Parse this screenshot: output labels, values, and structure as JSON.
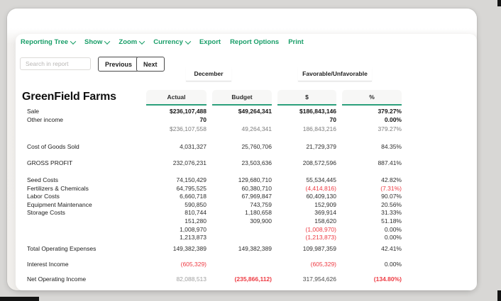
{
  "toolbar": {
    "items": [
      {
        "label": "Reporting Tree",
        "caret": true
      },
      {
        "label": "Show",
        "caret": true
      },
      {
        "label": "Zoom",
        "caret": true
      },
      {
        "label": "Currency",
        "caret": true
      },
      {
        "label": "Export",
        "caret": false
      },
      {
        "label": "Report Options",
        "caret": false
      },
      {
        "label": "Print",
        "caret": false
      }
    ]
  },
  "search": {
    "placeholder": "Search in report"
  },
  "pager": {
    "previous": "Previous",
    "next": "Next"
  },
  "report": {
    "title": "GreenField Farms",
    "groups": [
      {
        "label": "December"
      },
      {
        "label": "Favorable/Unfavorable"
      }
    ],
    "columns": [
      {
        "label": "Actual"
      },
      {
        "label": "Budget"
      },
      {
        "label": "$"
      },
      {
        "label": "%"
      }
    ],
    "rows": [
      {
        "label": "Sale",
        "gap": 0,
        "cells": [
          {
            "v": "$236,107,488",
            "c": "b"
          },
          {
            "v": "$49,264,341",
            "c": "b"
          },
          {
            "v": "$186,843,146",
            "c": "b"
          },
          {
            "v": "379.27%",
            "c": "b"
          }
        ]
      },
      {
        "label": "Other income",
        "gap": 0,
        "cells": [
          {
            "v": "70",
            "c": "b"
          },
          {
            "v": "",
            "c": ""
          },
          {
            "v": "70",
            "c": "b"
          },
          {
            "v": "0.00%",
            "c": "b"
          }
        ]
      },
      {
        "label": "",
        "gap": 2,
        "cells": [
          {
            "v": "$236,107,558",
            "c": "m"
          },
          {
            "v": "49,264,341",
            "c": "m"
          },
          {
            "v": "186,843,216",
            "c": "m"
          },
          {
            "v": "379.27%",
            "c": "m"
          }
        ]
      },
      {
        "label": "Cost of Goods Sold",
        "gap": 13,
        "cells": [
          {
            "v": "4,031,327",
            "c": ""
          },
          {
            "v": "25,760,706",
            "c": ""
          },
          {
            "v": "21,729,379",
            "c": ""
          },
          {
            "v": "84.35%",
            "c": ""
          }
        ]
      },
      {
        "label": "GROSS PROFIT",
        "gap": 12,
        "cells": [
          {
            "v": "232,076,231",
            "c": ""
          },
          {
            "v": "23,503,636",
            "c": ""
          },
          {
            "v": "208,572,596",
            "c": ""
          },
          {
            "v": "887.41%",
            "c": ""
          }
        ]
      },
      {
        "label": "Seed Costs",
        "gap": 12,
        "cells": [
          {
            "v": "74,150,429",
            "c": ""
          },
          {
            "v": "129,680,710",
            "c": ""
          },
          {
            "v": "55,534,445",
            "c": ""
          },
          {
            "v": "42.82%",
            "c": ""
          }
        ]
      },
      {
        "label": "Fertilizers & Chemicals",
        "gap": 0,
        "cells": [
          {
            "v": "64,795,525",
            "c": ""
          },
          {
            "v": "60,380,710",
            "c": ""
          },
          {
            "v": "(4,414,816)",
            "c": "r"
          },
          {
            "v": "(7.31%)",
            "c": "r"
          }
        ]
      },
      {
        "label": "Labor Costs",
        "gap": 0,
        "cells": [
          {
            "v": "6,660,718",
            "c": ""
          },
          {
            "v": "67,969,847",
            "c": ""
          },
          {
            "v": "60,409,130",
            "c": ""
          },
          {
            "v": "90.07%",
            "c": ""
          }
        ]
      },
      {
        "label": "Equipment Maintenance",
        "gap": 0,
        "cells": [
          {
            "v": "590,850",
            "c": ""
          },
          {
            "v": "743,759",
            "c": ""
          },
          {
            "v": "152,909",
            "c": ""
          },
          {
            "v": "20.56%",
            "c": ""
          }
        ]
      },
      {
        "label": "Storage Costs",
        "gap": 0,
        "cells": [
          {
            "v": "810,744",
            "c": ""
          },
          {
            "v": "1,180,658",
            "c": ""
          },
          {
            "v": "369,914",
            "c": ""
          },
          {
            "v": "31.33%",
            "c": ""
          }
        ]
      },
      {
        "label": "",
        "gap": 0,
        "cells": [
          {
            "v": "151,280",
            "c": ""
          },
          {
            "v": "309,900",
            "c": ""
          },
          {
            "v": "158,620",
            "c": ""
          },
          {
            "v": "51.18%",
            "c": ""
          }
        ]
      },
      {
        "label": "",
        "gap": 0,
        "cells": [
          {
            "v": "1,008,970",
            "c": ""
          },
          {
            "v": "",
            "c": ""
          },
          {
            "v": "(1,008,970)",
            "c": "r"
          },
          {
            "v": "0.00%",
            "c": ""
          }
        ]
      },
      {
        "label": "",
        "gap": 0,
        "cells": [
          {
            "v": "1,213,873",
            "c": ""
          },
          {
            "v": "",
            "c": ""
          },
          {
            "v": "(1,213,873)",
            "c": "r"
          },
          {
            "v": "0.00%",
            "c": ""
          }
        ]
      },
      {
        "label": "Total Operating Expenses",
        "gap": 4,
        "cells": [
          {
            "v": "149,382,389",
            "c": ""
          },
          {
            "v": "149,382,389",
            "c": ""
          },
          {
            "v": "109,987,359",
            "c": ""
          },
          {
            "v": "42.41%",
            "c": ""
          }
        ]
      },
      {
        "label": "Interest Income",
        "gap": 11,
        "cells": [
          {
            "v": "(605,329)",
            "c": "r"
          },
          {
            "v": "",
            "c": ""
          },
          {
            "v": "(605,329)",
            "c": "r"
          },
          {
            "v": "0.00%",
            "c": ""
          }
        ]
      },
      {
        "label": "Net Operating Income",
        "gap": 9,
        "cells": [
          {
            "v": "82,088,513",
            "c": "f"
          },
          {
            "v": "(235,866,112)",
            "c": "rb"
          },
          {
            "v": "317,954,626",
            "c": "d"
          },
          {
            "v": "(134.80%)",
            "c": "rb"
          }
        ]
      }
    ]
  },
  "colors": {
    "accent_green": "#189e68",
    "header_underline_green": "#2ba07b",
    "negative_red": "#ee3a42"
  }
}
